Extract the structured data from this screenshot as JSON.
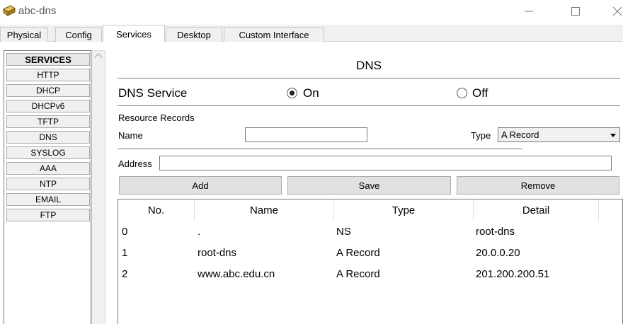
{
  "window": {
    "title": "abc-dns",
    "app_icon": "packet-tracer-icon",
    "controls": [
      "minimize-icon",
      "maximize-icon",
      "close-icon"
    ]
  },
  "tabs": [
    {
      "label": "Physical",
      "active": false
    },
    {
      "label": "Config",
      "active": false
    },
    {
      "label": "Services",
      "active": true
    },
    {
      "label": "Desktop",
      "active": false
    },
    {
      "label": "Custom Interface",
      "active": false
    }
  ],
  "services": {
    "header": "SERVICES",
    "items": [
      "HTTP",
      "DHCP",
      "DHCPv6",
      "TFTP",
      "DNS",
      "SYSLOG",
      "AAA",
      "NTP",
      "EMAIL",
      "FTP"
    ]
  },
  "dns": {
    "title": "DNS",
    "service_label": "DNS Service",
    "on_label": "On",
    "off_label": "Off",
    "selected": "On",
    "resource_records_label": "Resource Records",
    "name_label": "Name",
    "name_value": "",
    "type_label": "Type",
    "type_value": "A Record",
    "address_label": "Address",
    "address_value": "",
    "add_label": "Add",
    "save_label": "Save",
    "remove_label": "Remove"
  },
  "table": {
    "headers": [
      "No.",
      "Name",
      "Type",
      "Detail"
    ],
    "rows": [
      {
        "no": "0",
        "name": ".",
        "type": "NS",
        "detail": "root-dns"
      },
      {
        "no": "1",
        "name": "root-dns",
        "type": "A Record",
        "detail": "20.0.0.20"
      },
      {
        "no": "2",
        "name": "www.abc.edu.cn",
        "type": "A Record",
        "detail": "201.200.200.51"
      }
    ]
  }
}
